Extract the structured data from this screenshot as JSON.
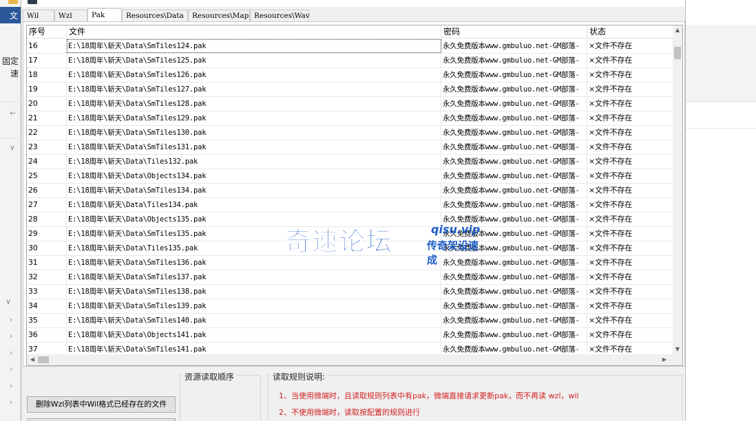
{
  "background": {
    "left_labels": [
      "文",
      "固定",
      "速"
    ]
  },
  "tabs": [
    {
      "label": "Wil",
      "active": false
    },
    {
      "label": "Wzl",
      "active": false
    },
    {
      "label": "Pak",
      "active": true
    },
    {
      "label": "Resources\\Data",
      "active": false
    },
    {
      "label": "Resources\\Map",
      "active": false
    },
    {
      "label": "Resources\\Wav",
      "active": false
    }
  ],
  "table": {
    "columns": [
      "序号",
      "文件",
      "密码",
      "状态"
    ],
    "rows": [
      {
        "seq": "16",
        "file": "E:\\18周年\\斩天\\Data\\SmTiles124.pak",
        "password": "永久免费版本www.gmbuluo.net-GM部落-",
        "status": "×文件不存在"
      },
      {
        "seq": "17",
        "file": "E:\\18周年\\斩天\\Data\\SmTiles125.pak",
        "password": "永久免费版本www.gmbuluo.net-GM部落-",
        "status": "×文件不存在"
      },
      {
        "seq": "18",
        "file": "E:\\18周年\\斩天\\Data\\SmTiles126.pak",
        "password": "永久免费版本www.gmbuluo.net-GM部落-",
        "status": "×文件不存在"
      },
      {
        "seq": "19",
        "file": "E:\\18周年\\斩天\\Data\\SmTiles127.pak",
        "password": "永久免费版本www.gmbuluo.net-GM部落-",
        "status": "×文件不存在"
      },
      {
        "seq": "20",
        "file": "E:\\18周年\\斩天\\Data\\SmTiles128.pak",
        "password": "永久免费版本www.gmbuluo.net-GM部落-",
        "status": "×文件不存在"
      },
      {
        "seq": "21",
        "file": "E:\\18周年\\斩天\\Data\\SmTiles129.pak",
        "password": "永久免费版本www.gmbuluo.net-GM部落-",
        "status": "×文件不存在"
      },
      {
        "seq": "22",
        "file": "E:\\18周年\\斩天\\Data\\SmTiles130.pak",
        "password": "永久免费版本www.gmbuluo.net-GM部落-",
        "status": "×文件不存在"
      },
      {
        "seq": "23",
        "file": "E:\\18周年\\斩天\\Data\\SmTiles131.pak",
        "password": "永久免费版本www.gmbuluo.net-GM部落-",
        "status": "×文件不存在"
      },
      {
        "seq": "24",
        "file": "E:\\18周年\\斩天\\Data\\Tiles132.pak",
        "password": "永久免费版本www.gmbuluo.net-GM部落-",
        "status": "×文件不存在"
      },
      {
        "seq": "25",
        "file": "E:\\18周年\\斩天\\Data\\Objects134.pak",
        "password": "永久免费版本www.gmbuluo.net-GM部落-",
        "status": "×文件不存在"
      },
      {
        "seq": "26",
        "file": "E:\\18周年\\斩天\\Data\\SmTiles134.pak",
        "password": "永久免费版本www.gmbuluo.net-GM部落-",
        "status": "×文件不存在"
      },
      {
        "seq": "27",
        "file": "E:\\18周年\\斩天\\Data\\Tiles134.pak",
        "password": "永久免费版本www.gmbuluo.net-GM部落-",
        "status": "×文件不存在"
      },
      {
        "seq": "28",
        "file": "E:\\18周年\\斩天\\Data\\Objects135.pak",
        "password": "永久免费版本www.gmbuluo.net-GM部落-",
        "status": "×文件不存在"
      },
      {
        "seq": "29",
        "file": "E:\\18周年\\斩天\\Data\\SmTiles135.pak",
        "password": "永久免费版本www.gmbuluo.net-GM部落-",
        "status": "×文件不存在"
      },
      {
        "seq": "30",
        "file": "E:\\18周年\\斩天\\Data\\Tiles135.pak",
        "password": "永久免费版本www.gmbuluo.net-GM部落-",
        "status": "×文件不存在"
      },
      {
        "seq": "31",
        "file": "E:\\18周年\\斩天\\Data\\SmTiles136.pak",
        "password": "永久免费版本www.gmbuluo.net-GM部落-",
        "status": "×文件不存在"
      },
      {
        "seq": "32",
        "file": "E:\\18周年\\斩天\\Data\\SmTiles137.pak",
        "password": "永久免费版本www.gmbuluo.net-GM部落-",
        "status": "×文件不存在"
      },
      {
        "seq": "33",
        "file": "E:\\18周年\\斩天\\Data\\SmTiles138.pak",
        "password": "永久免费版本www.gmbuluo.net-GM部落-",
        "status": "×文件不存在"
      },
      {
        "seq": "34",
        "file": "E:\\18周年\\斩天\\Data\\SmTiles139.pak",
        "password": "永久免费版本www.gmbuluo.net-GM部落-",
        "status": "×文件不存在"
      },
      {
        "seq": "35",
        "file": "E:\\18周年\\斩天\\Data\\SmTiles140.pak",
        "password": "永久免费版本www.gmbuluo.net-GM部落-",
        "status": "×文件不存在"
      },
      {
        "seq": "36",
        "file": "E:\\18周年\\斩天\\Data\\Objects141.pak",
        "password": "永久免费版本www.gmbuluo.net-GM部落-",
        "status": "×文件不存在"
      },
      {
        "seq": "37",
        "file": "E:\\18周年\\斩天\\Data\\SmTiles141.pak",
        "password": "永久免费版本www.gmbuluo.net-GM部落-",
        "status": "×文件不存在"
      }
    ]
  },
  "watermark": {
    "main": "奇速论坛",
    "url": "qisu.vip",
    "sub": "传奇架设速成"
  },
  "bottom": {
    "delete_button_label": "删除Wzl列表中Wil格式已经存在的文件",
    "order_group_label": "资源读取顺序",
    "rules_group_label": "读取规则说明:",
    "rules": [
      "1、当使用微端时，且读取规则列表中有pak，微端直接请求更新pak，而不再读 wzl，wil",
      "2、不使用微端时，读取按配置的规则进行"
    ]
  },
  "colors": {
    "accent_blue": "#2b579a",
    "watermark_blue": "#1f5ec7",
    "rule_red": "#d21f1f"
  }
}
